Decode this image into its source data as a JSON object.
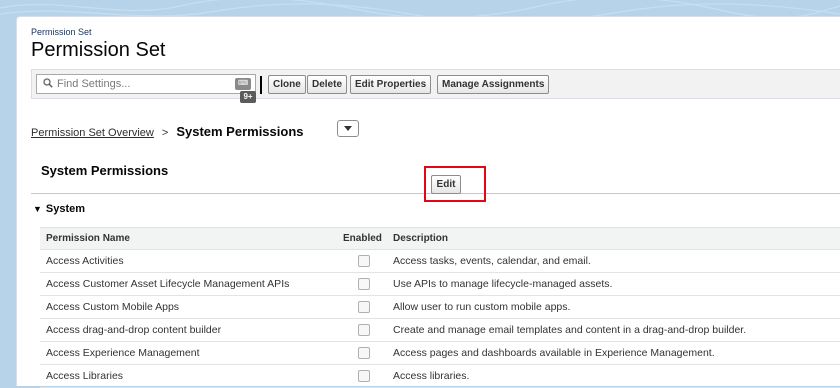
{
  "header": {
    "object_type": "Permission Set",
    "title": "Permission Set"
  },
  "toolbar": {
    "search_placeholder": "Find Settings...",
    "search_badge": "9+",
    "buttons": [
      "Clone",
      "Delete",
      "Edit Properties",
      "Manage Assignments"
    ]
  },
  "breadcrumb": {
    "link": "Permission Set Overview",
    "separator": ">",
    "current": "System Permissions"
  },
  "section": {
    "title": "System Permissions",
    "edit_label": "Edit",
    "group_title": "System"
  },
  "table": {
    "columns": [
      "Permission Name",
      "Enabled",
      "Description"
    ],
    "rows": [
      {
        "name": "Access Activities",
        "enabled": false,
        "description": "Access tasks, events, calendar, and email."
      },
      {
        "name": "Access Customer Asset Lifecycle Management APIs",
        "enabled": false,
        "description": "Use APIs to manage lifecycle-managed assets."
      },
      {
        "name": "Access Custom Mobile Apps",
        "enabled": false,
        "description": "Allow user to run custom mobile apps."
      },
      {
        "name": "Access drag-and-drop content builder",
        "enabled": false,
        "description": "Create and manage email templates and content in a drag-and-drop builder."
      },
      {
        "name": "Access Experience Management",
        "enabled": false,
        "description": "Access pages and dashboards available in Experience Management."
      },
      {
        "name": "Access Libraries",
        "enabled": false,
        "description": "Access libraries."
      }
    ]
  },
  "colors": {
    "background": "#b7d3ea",
    "highlight": "#e30613"
  }
}
